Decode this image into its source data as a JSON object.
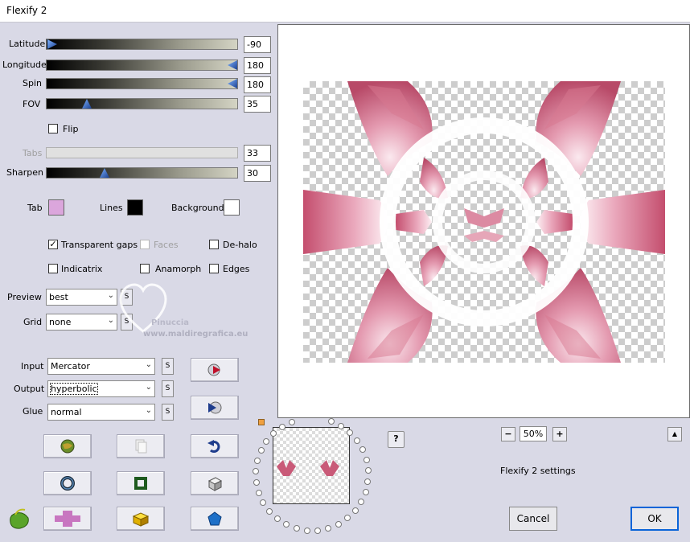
{
  "window": {
    "title": "Flexify 2"
  },
  "sliders": {
    "latitude": {
      "label": "Latitude",
      "value": "-90",
      "level": 0.0
    },
    "longitude": {
      "label": "Longitude",
      "value": "180",
      "level": 1.0
    },
    "spin": {
      "label": "Spin",
      "value": "180",
      "level": 1.0
    },
    "fov": {
      "label": "FOV",
      "value": "35",
      "level": 0.2
    },
    "tabs": {
      "label": "Tabs",
      "value": "33",
      "level": 0.33
    },
    "sharpen": {
      "label": "Sharpen",
      "value": "30",
      "level": 0.3
    }
  },
  "flip": {
    "label": "Flip",
    "checked": false
  },
  "colors": {
    "tab": {
      "label": "Tab",
      "color": "#dba6dc"
    },
    "lines": {
      "label": "Lines",
      "color": "#000000"
    },
    "background": {
      "label": "Background",
      "color": "#ffffff"
    }
  },
  "options": {
    "transparent_gaps": {
      "label": "Transparent gaps",
      "checked": true
    },
    "faces": {
      "label": "Faces",
      "checked": false
    },
    "de_halo": {
      "label": "De-halo",
      "checked": false
    },
    "indicatrix": {
      "label": "Indicatrix",
      "checked": false
    },
    "anamorph": {
      "label": "Anamorph",
      "checked": false
    },
    "edges": {
      "label": "Edges",
      "checked": false
    }
  },
  "preview_select": {
    "label": "Preview",
    "value": "best"
  },
  "grid_select": {
    "label": "Grid",
    "value": "none"
  },
  "input_select": {
    "label": "Input",
    "value": "Mercator"
  },
  "output_select": {
    "label": "Output",
    "value": "hyperbolic"
  },
  "glue_select": {
    "label": "Glue",
    "value": "normal"
  },
  "small_button_glyph": "S",
  "watermark": {
    "line1": "Pinuccia",
    "line2": "www.maldiregrafica.eu"
  },
  "zoom": {
    "value": "50%",
    "minus": "−",
    "plus": "+"
  },
  "help_button": "?",
  "collapse_button": "▲",
  "settings_label": "Flexify 2 settings",
  "buttons": {
    "cancel": "Cancel",
    "ok": "OK"
  },
  "accent_color": "#c95a78"
}
